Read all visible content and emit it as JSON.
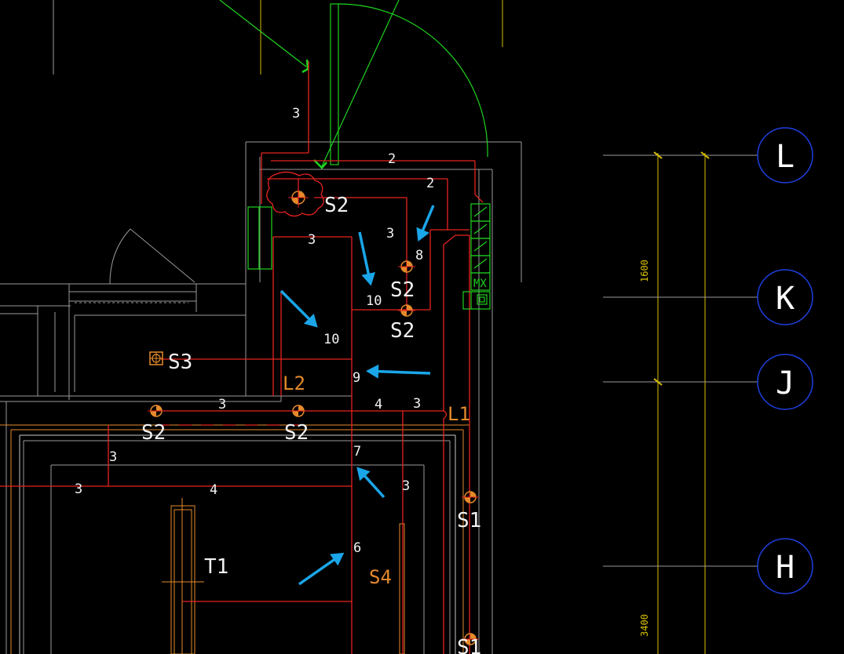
{
  "colors": {
    "background": "#000000",
    "circuit": "#e8231f",
    "wall": "#9a9a9a",
    "fixture": "#e58a2b",
    "grid": "#d8c000",
    "door": "#1fd21f",
    "axis_bubble": "#1f3fe0",
    "annotation_arrow": "#1aa6e8"
  },
  "wire_counts": {
    "n3_top": "3",
    "n2_upper": "2",
    "n2_lower": "2",
    "n3_mid_left": "3",
    "n3_mid_right": "3",
    "n8": "8",
    "n10_upper": "10",
    "n10_lower": "10",
    "n9": "9",
    "n4_upper": "4",
    "n3_upper_row": "3",
    "n3_right_row": "3",
    "n3_left_a": "3",
    "n3_left_b": "3",
    "n4_lower": "4",
    "n7": "7",
    "n3_vertical": "3",
    "n6": "6"
  },
  "fixtures": {
    "s2_top": "S2",
    "s2_mid_a": "S2",
    "s2_mid_b": "S2",
    "s2_row_a": "S2",
    "s2_row_b": "S2",
    "s3": "S3",
    "s1_a": "S1",
    "s1_b": "S1",
    "s4": "S4",
    "l1": "L1",
    "l2": "L2",
    "t1": "T1"
  },
  "panel": {
    "label": "MX"
  },
  "axes": {
    "bubbles": [
      "L",
      "K",
      "J",
      "H"
    ]
  },
  "dimensions": {
    "upper": "1600",
    "lower": "3400"
  }
}
